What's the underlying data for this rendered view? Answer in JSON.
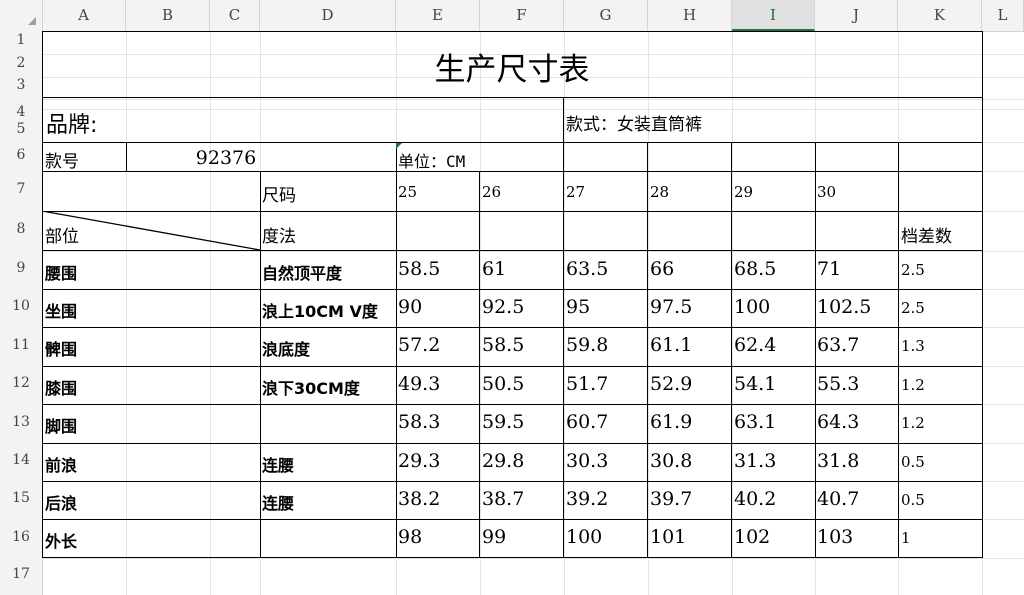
{
  "columns": [
    "A",
    "B",
    "C",
    "D",
    "E",
    "F",
    "G",
    "H",
    "I",
    "J",
    "K",
    "L"
  ],
  "selected_column": "I",
  "rows": [
    "1",
    "2",
    "3",
    "4",
    "5",
    "6",
    "7",
    "8",
    "9",
    "10",
    "11",
    "12",
    "13",
    "14",
    "15",
    "16",
    "17"
  ],
  "sheet": {
    "title": "生产尺寸表",
    "brand_label": "品牌:",
    "style_label": "款式：女装直筒裤",
    "style_no_label": "款号",
    "style_no_value": "92376",
    "unit_label": "单位：CM",
    "size_label": "尺码",
    "sizes": [
      "25",
      "26",
      "27",
      "28",
      "29",
      "30"
    ],
    "part_label": "部位",
    "method_label": "度法",
    "grade_label": "档差数",
    "measurements": [
      {
        "part": "腰围",
        "method": "自然顶平度",
        "values": [
          "58.5",
          "61",
          "63.5",
          "66",
          "68.5",
          "71"
        ],
        "grade": "2.5"
      },
      {
        "part": "坐围",
        "method": "浪上10CM V度",
        "values": [
          "90",
          "92.5",
          "95",
          "97.5",
          "100",
          "102.5"
        ],
        "grade": "2.5"
      },
      {
        "part": "髀围",
        "method": "浪底度",
        "values": [
          "57.2",
          "58.5",
          "59.8",
          "61.1",
          "62.4",
          "63.7"
        ],
        "grade": "1.3"
      },
      {
        "part": "膝围",
        "method": "浪下30CM度",
        "values": [
          "49.3",
          "50.5",
          "51.7",
          "52.9",
          "54.1",
          "55.3"
        ],
        "grade": "1.2"
      },
      {
        "part": "脚围",
        "method": "",
        "values": [
          "58.3",
          "59.5",
          "60.7",
          "61.9",
          "63.1",
          "64.3"
        ],
        "grade": "1.2"
      },
      {
        "part": "前浪",
        "method": "连腰",
        "values": [
          "29.3",
          "29.8",
          "30.3",
          "30.8",
          "31.3",
          "31.8"
        ],
        "grade": "0.5"
      },
      {
        "part": "后浪",
        "method": "连腰",
        "values": [
          "38.2",
          "38.7",
          "39.2",
          "39.7",
          "40.2",
          "40.7"
        ],
        "grade": "0.5"
      },
      {
        "part": "外长",
        "method": "",
        "values": [
          "98",
          "99",
          "100",
          "101",
          "102",
          "103"
        ],
        "grade": "1"
      }
    ]
  }
}
